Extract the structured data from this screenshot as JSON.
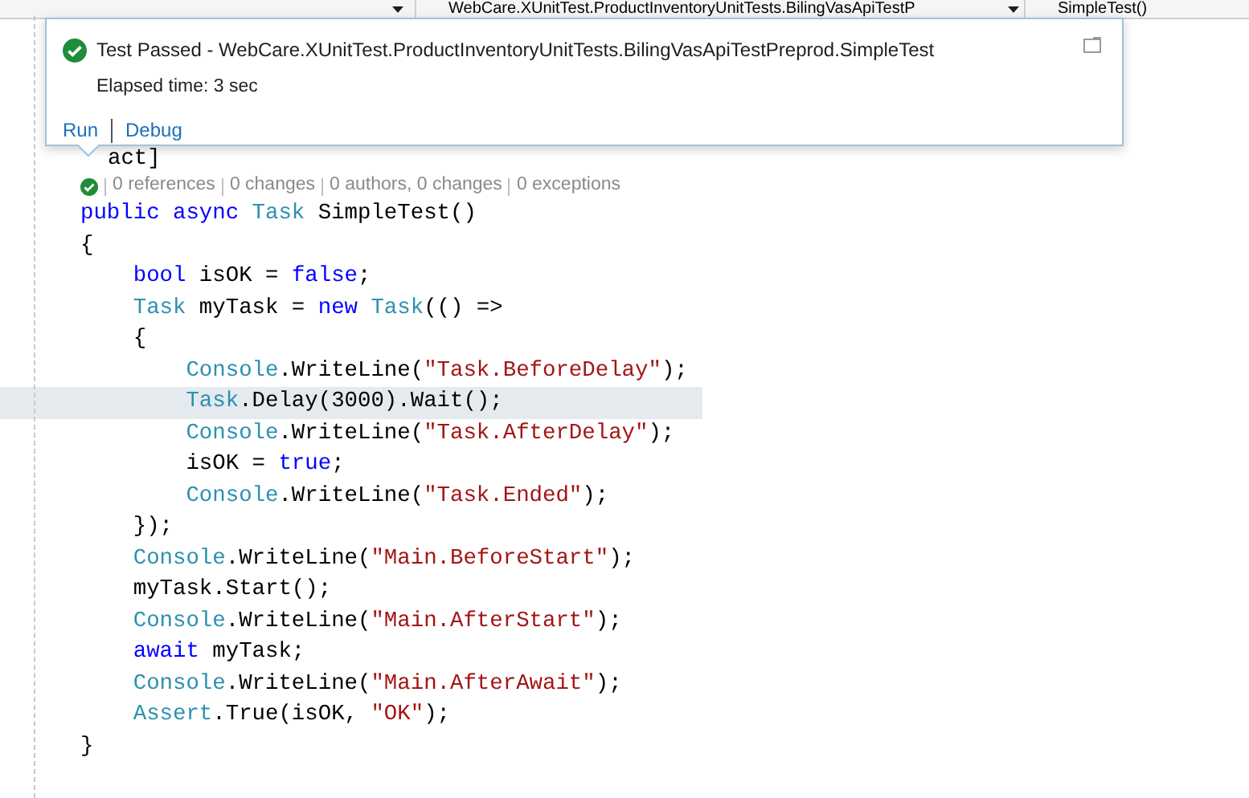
{
  "toolbar": {
    "class_dropdown": "WebCare.XUnitTest.ProductInventoryUnitTests.BilingVasApiTestP",
    "member_dropdown": "SimpleTest()"
  },
  "popup": {
    "passed": true,
    "title": "Test Passed - WebCare.XUnitTest.ProductInventoryUnitTests.BilingVasApiTestPreprod.SimpleTest",
    "elapsed": "Elapsed time: 3 sec",
    "actions": [
      "Run",
      "Debug"
    ]
  },
  "editor": {
    "covered_line": "act]",
    "codelens": {
      "passed": true,
      "items": [
        "0 references",
        "0 changes",
        "0 authors, 0 changes",
        "0 exceptions"
      ]
    },
    "lines": [
      {
        "highlighted": false,
        "tokens": [
          {
            "kind": "kw",
            "text": "public async "
          },
          {
            "kind": "type",
            "text": "Task"
          },
          {
            "kind": "plain",
            "text": " SimpleTest()"
          }
        ]
      },
      {
        "highlighted": false,
        "tokens": [
          {
            "kind": "plain",
            "text": "{"
          }
        ]
      },
      {
        "highlighted": false,
        "tokens": [
          {
            "kind": "kw",
            "text": "    bool"
          },
          {
            "kind": "plain",
            "text": " isOK = "
          },
          {
            "kind": "kw",
            "text": "false"
          },
          {
            "kind": "plain",
            "text": ";"
          }
        ]
      },
      {
        "highlighted": false,
        "tokens": [
          {
            "kind": "type",
            "text": "    Task"
          },
          {
            "kind": "plain",
            "text": " myTask = "
          },
          {
            "kind": "kw",
            "text": "new "
          },
          {
            "kind": "type",
            "text": "Task"
          },
          {
            "kind": "plain",
            "text": "(() =>"
          }
        ]
      },
      {
        "highlighted": false,
        "tokens": [
          {
            "kind": "plain",
            "text": "    {"
          }
        ]
      },
      {
        "highlighted": false,
        "tokens": [
          {
            "kind": "type",
            "text": "        Console"
          },
          {
            "kind": "plain",
            "text": ".WriteLine("
          },
          {
            "kind": "str",
            "text": "\"Task.BeforeDelay\""
          },
          {
            "kind": "plain",
            "text": ");"
          }
        ]
      },
      {
        "highlighted": true,
        "tokens": [
          {
            "kind": "type",
            "text": "        Task"
          },
          {
            "kind": "plain",
            "text": ".Delay(3000).Wait();"
          }
        ]
      },
      {
        "highlighted": false,
        "tokens": [
          {
            "kind": "type",
            "text": "        Console"
          },
          {
            "kind": "plain",
            "text": ".WriteLine("
          },
          {
            "kind": "str",
            "text": "\"Task.AfterDelay\""
          },
          {
            "kind": "plain",
            "text": ");"
          }
        ]
      },
      {
        "highlighted": false,
        "tokens": [
          {
            "kind": "plain",
            "text": "        isOK = "
          },
          {
            "kind": "kw",
            "text": "true"
          },
          {
            "kind": "plain",
            "text": ";"
          }
        ]
      },
      {
        "highlighted": false,
        "tokens": [
          {
            "kind": "type",
            "text": "        Console"
          },
          {
            "kind": "plain",
            "text": ".WriteLine("
          },
          {
            "kind": "str",
            "text": "\"Task.Ended\""
          },
          {
            "kind": "plain",
            "text": ");"
          }
        ]
      },
      {
        "highlighted": false,
        "tokens": [
          {
            "kind": "plain",
            "text": "    });"
          }
        ]
      },
      {
        "highlighted": false,
        "tokens": [
          {
            "kind": "type",
            "text": "    Console"
          },
          {
            "kind": "plain",
            "text": ".WriteLine("
          },
          {
            "kind": "str",
            "text": "\"Main.BeforeStart\""
          },
          {
            "kind": "plain",
            "text": ");"
          }
        ]
      },
      {
        "highlighted": false,
        "tokens": [
          {
            "kind": "plain",
            "text": "    myTask.Start();"
          }
        ]
      },
      {
        "highlighted": false,
        "tokens": [
          {
            "kind": "type",
            "text": "    Console"
          },
          {
            "kind": "plain",
            "text": ".WriteLine("
          },
          {
            "kind": "str",
            "text": "\"Main.AfterStart\""
          },
          {
            "kind": "plain",
            "text": ");"
          }
        ]
      },
      {
        "highlighted": false,
        "tokens": [
          {
            "kind": "kw",
            "text": "    await"
          },
          {
            "kind": "plain",
            "text": " myTask;"
          }
        ]
      },
      {
        "highlighted": false,
        "tokens": [
          {
            "kind": "type",
            "text": "    Console"
          },
          {
            "kind": "plain",
            "text": ".WriteLine("
          },
          {
            "kind": "str",
            "text": "\"Main.AfterAwait\""
          },
          {
            "kind": "plain",
            "text": ");"
          }
        ]
      },
      {
        "highlighted": false,
        "tokens": [
          {
            "kind": "type",
            "text": "    Assert"
          },
          {
            "kind": "plain",
            "text": ".True(isOK, "
          },
          {
            "kind": "str",
            "text": "\"OK\""
          },
          {
            "kind": "plain",
            "text": ");"
          }
        ]
      },
      {
        "highlighted": false,
        "tokens": [
          {
            "kind": "plain",
            "text": "}"
          }
        ]
      }
    ]
  }
}
